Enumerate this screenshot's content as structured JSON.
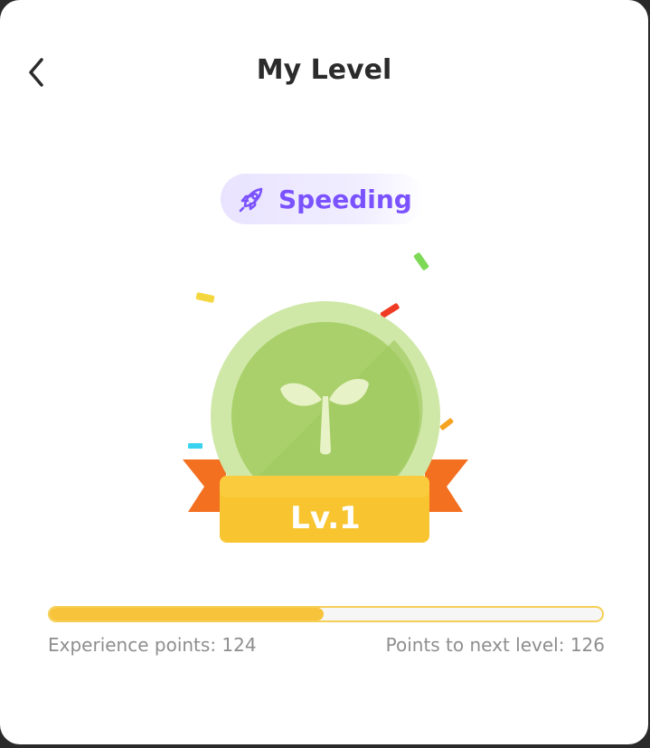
{
  "header": {
    "title": "My Level",
    "back_icon": "chevron-left-icon"
  },
  "status_badge": {
    "icon": "rocket-icon",
    "label": "Speeding",
    "color": "#7a52ff"
  },
  "medal": {
    "icon": "sprout-icon",
    "level_label": "Lv.1"
  },
  "progress": {
    "fraction": 0.496,
    "experience_text": "Experience points: 124",
    "next_level_text": "Points to next level: 126"
  }
}
